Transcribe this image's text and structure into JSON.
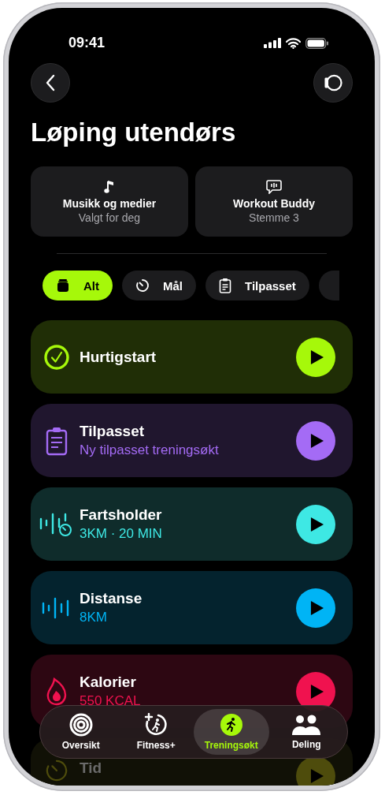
{
  "status_bar": {
    "time": "09:41"
  },
  "title": "Løping utendørs",
  "settings_cards": [
    {
      "kind": "music",
      "title": "Musikk og medier",
      "subtitle": "Valgt for deg"
    },
    {
      "kind": "buddy",
      "title": "Workout Buddy",
      "subtitle": "Stemme 3"
    }
  ],
  "filter_chips": [
    {
      "kind": "stack",
      "label": "Alt",
      "selected": true
    },
    {
      "kind": "timer",
      "label": "Mål",
      "selected": false
    },
    {
      "kind": "clipboard",
      "label": "Tilpasset",
      "selected": false
    }
  ],
  "workouts": [
    {
      "kind": "check",
      "title": "Hurtigstart",
      "color": "#a6f80a"
    },
    {
      "kind": "clipboard",
      "title": "Tilpasset",
      "subtitle": "Ny tilpasset treningsøkt",
      "color": "#a46bf5"
    },
    {
      "kind": "pace",
      "title": "Fartsholder",
      "subtitle": "3KM · 20 MIN",
      "color": "#3ee8e4"
    },
    {
      "kind": "distance",
      "title": "Distanse",
      "subtitle": "8KM",
      "color": "#00b4f5"
    },
    {
      "kind": "flame",
      "title": "Kalorier",
      "subtitle": "550 KCAL",
      "color": "#f0124f"
    },
    {
      "kind": "timer",
      "title": "Tid",
      "color": "#4e4c0c"
    }
  ],
  "tab_bar": [
    {
      "kind": "rings",
      "label": "Oversikt",
      "selected": false
    },
    {
      "kind": "fitness",
      "label": "Fitness+",
      "selected": false
    },
    {
      "kind": "runner",
      "label": "Treningsøkt",
      "selected": true
    },
    {
      "kind": "people",
      "label": "Deling",
      "selected": false
    }
  ]
}
